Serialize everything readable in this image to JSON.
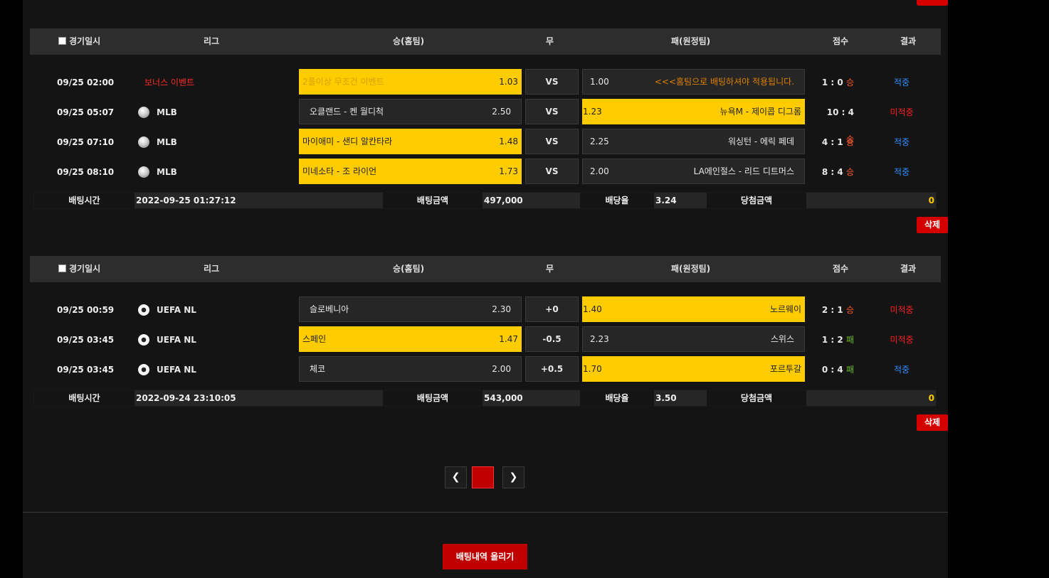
{
  "header": {
    "select_all": "경기일시",
    "league": "리그",
    "home": "승(홈팀)",
    "draw": "무",
    "away": "패(원정팀)",
    "score": "점수",
    "result": "결과"
  },
  "slips": [
    {
      "rows": [
        {
          "datetime": "09/25 02:00",
          "league": "보너스 이벤트",
          "home_name": "2폴이상 무조건 이벤트",
          "home_odds": "1.03",
          "draw": "VS",
          "away_odds": "1.00",
          "away_name": "<<<홈팀으로 배팅하셔야 적용됩니다.",
          "score": "1 : 0",
          "outcome": "승",
          "result": "적중"
        },
        {
          "datetime": "09/25 05:07",
          "league": "MLB",
          "home_name": "오클랜드 - 켄 월디척",
          "home_odds": "2.50",
          "draw": "VS",
          "away_odds": "1.23",
          "away_name": "뉴욕M - 제이콥 디그롬",
          "score": "10 : 4",
          "outcome": "승",
          "result": "미적중"
        },
        {
          "datetime": "09/25 07:10",
          "league": "MLB",
          "home_name": "마이애미 - 샌디 알칸타라",
          "home_odds": "1.48",
          "draw": "VS",
          "away_odds": "2.25",
          "away_name": "워싱턴 - 에릭 페데",
          "score": "4 : 1",
          "outcome": "승",
          "result": "적중"
        },
        {
          "datetime": "09/25 08:10",
          "league": "MLB",
          "home_name": "미네소타 - 조 라이언",
          "home_odds": "1.73",
          "draw": "VS",
          "away_odds": "2.00",
          "away_name": "LA에인절스 - 리드 디트머스",
          "score": "8 : 4",
          "outcome": "승",
          "result": "적중"
        }
      ],
      "summary": {
        "time_label": "배팅시간",
        "time": "2022-09-25 01:27:12",
        "amount_label": "배팅금액",
        "amount": "497,000",
        "rate_label": "배당율",
        "rate": "3.24",
        "win_label": "당첨금액",
        "win": "0"
      },
      "delete_label": "삭제"
    },
    {
      "rows": [
        {
          "datetime": "09/25 00:59",
          "league": "UEFA NL",
          "home_name": "슬로베니아",
          "home_odds": "2.30",
          "draw": "+0",
          "away_odds": "1.40",
          "away_name": "노르웨이",
          "score": "2 : 1",
          "outcome": "승",
          "result": "미적중"
        },
        {
          "datetime": "09/25 03:45",
          "league": "UEFA NL",
          "home_name": "스페인",
          "home_odds": "1.47",
          "draw": "-0.5",
          "away_odds": "2.23",
          "away_name": "스위스",
          "score": "1 : 2",
          "outcome": "패",
          "result": "미적중"
        },
        {
          "datetime": "09/25 03:45",
          "league": "UEFA NL",
          "home_name": "체코",
          "home_odds": "2.00",
          "draw": "+0.5",
          "away_odds": "1.70",
          "away_name": "포르투갈",
          "score": "0 : 4",
          "outcome": "패",
          "result": "적중"
        }
      ],
      "summary": {
        "time_label": "배팅시간",
        "time": "2022-09-24 23:10:05",
        "amount_label": "배팅금액",
        "amount": "543,000",
        "rate_label": "배당율",
        "rate": "3.50",
        "win_label": "당첨금액",
        "win": "0"
      },
      "delete_label": "삭제"
    }
  ],
  "pagination": {
    "prev_icon": "chevron-left-icon",
    "current": "1",
    "next_icon": "chevron-right-icon"
  },
  "upload_button": "배팅내역 올리기",
  "colors": {
    "selected": "#ffcc00",
    "accent_red": "#d40000",
    "hit": "#2f8fff",
    "miss": "#ff2020"
  }
}
